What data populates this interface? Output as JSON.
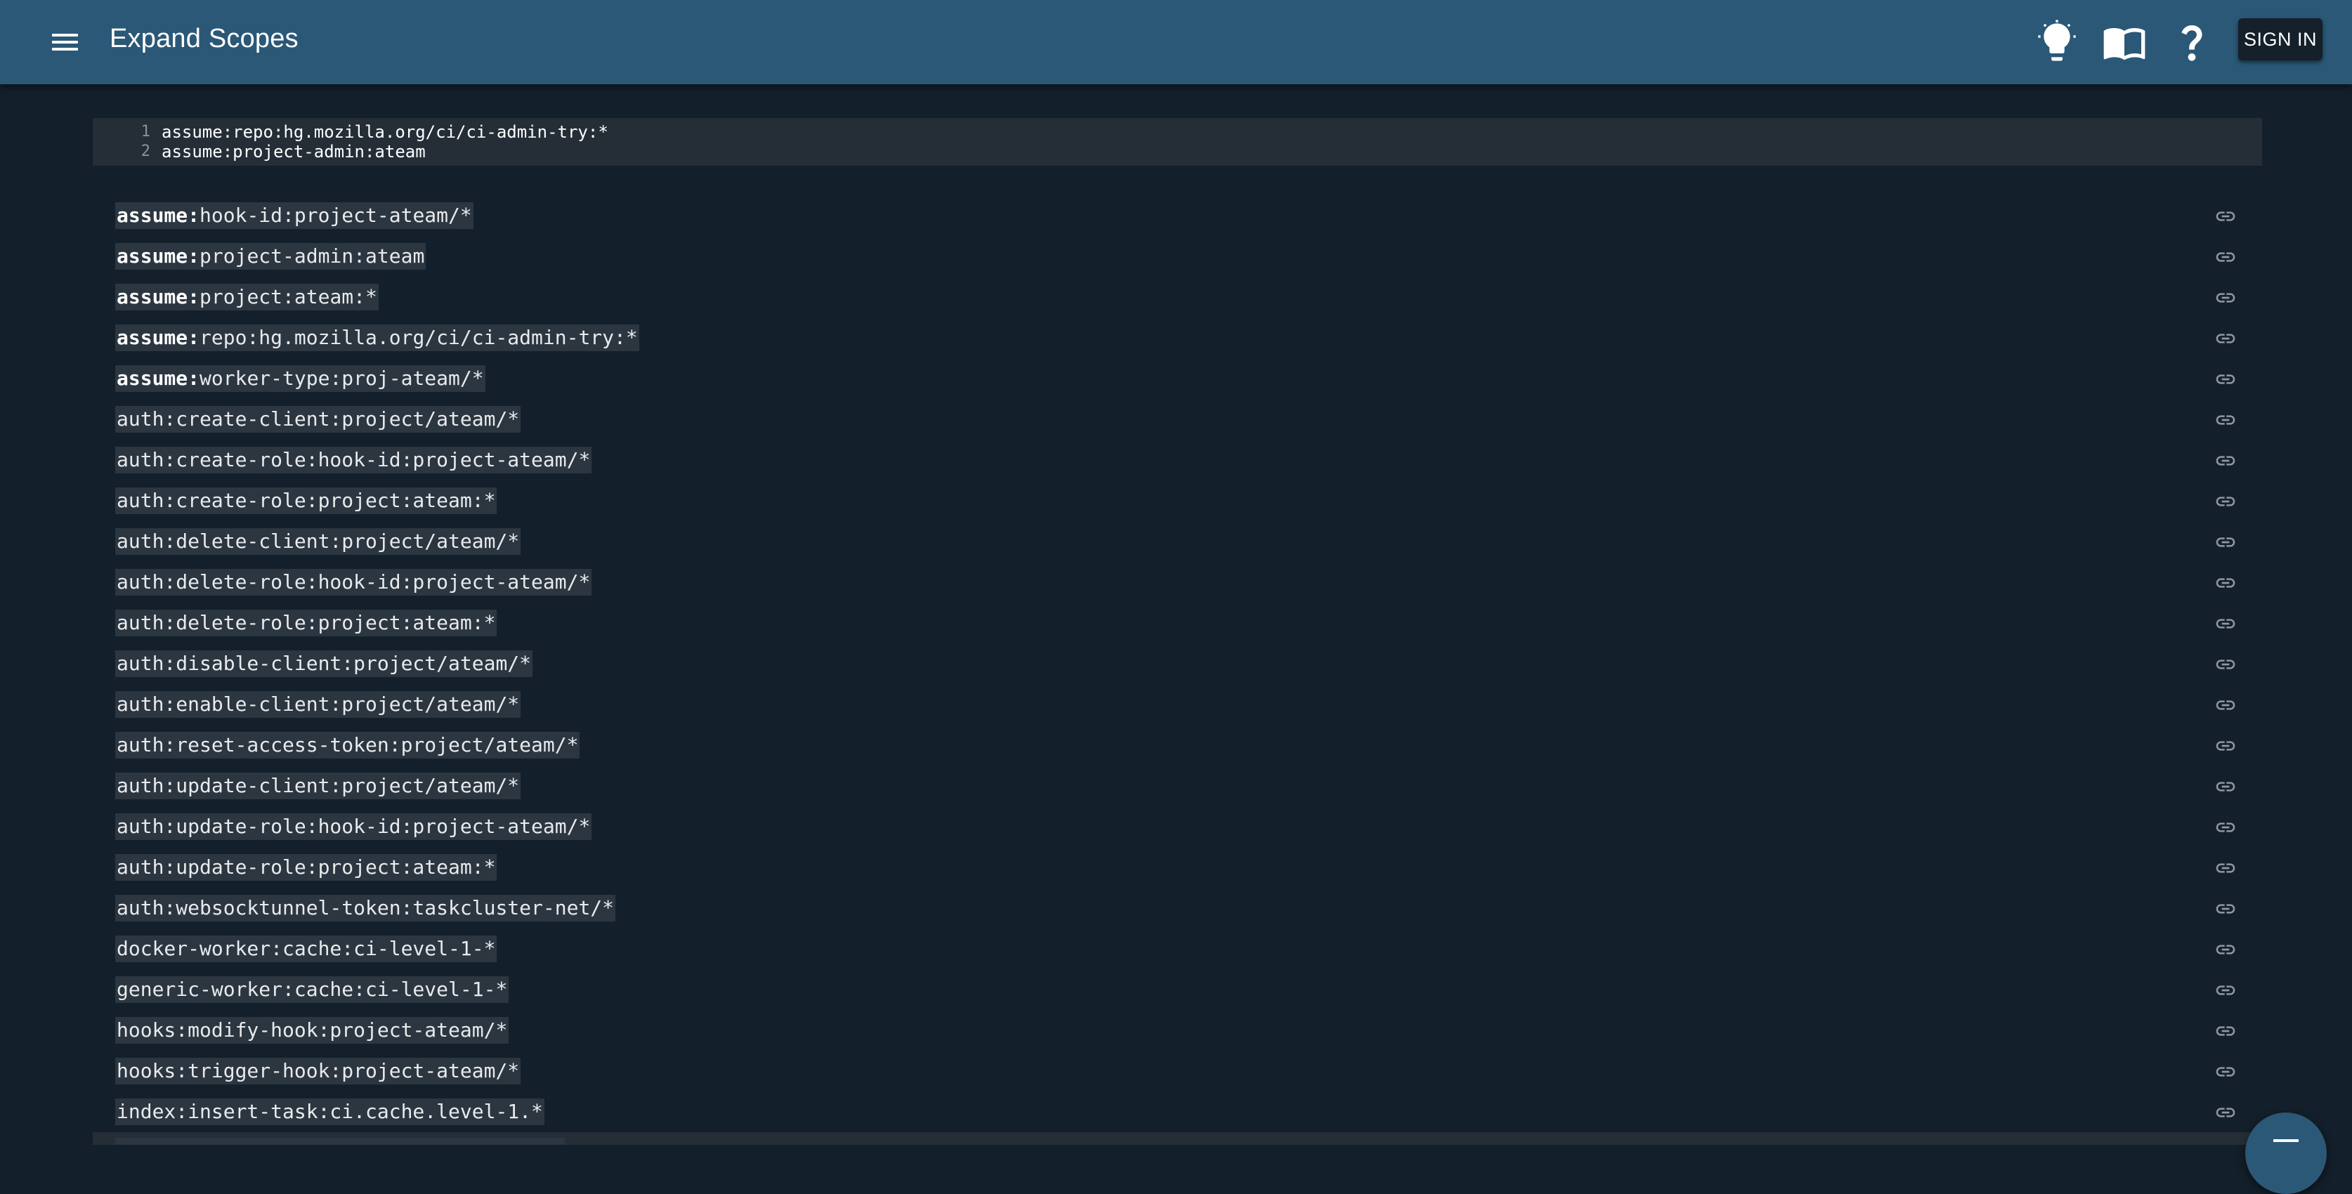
{
  "app": {
    "title": "Expand Scopes",
    "sign_in_label": "SIGN IN"
  },
  "icons": {
    "menu": "menu-icon",
    "theme": "lightbulb-icon",
    "docs": "book-icon",
    "help": "help-icon",
    "copy_link": "link-icon"
  },
  "editor": {
    "lines": [
      {
        "number": "1",
        "text": "assume:repo:hg.mozilla.org/ci/ci-admin-try:*"
      },
      {
        "number": "2",
        "text": "assume:project-admin:ateam"
      }
    ]
  },
  "scopes": [
    {
      "prefix": "assume:",
      "rest": "hook-id:project-ateam/*"
    },
    {
      "prefix": "assume:",
      "rest": "project-admin:ateam"
    },
    {
      "prefix": "assume:",
      "rest": "project:ateam:*"
    },
    {
      "prefix": "assume:",
      "rest": "repo:hg.mozilla.org/ci/ci-admin-try:*"
    },
    {
      "prefix": "assume:",
      "rest": "worker-type:proj-ateam/*"
    },
    {
      "prefix": "",
      "rest": "auth:create-client:project/ateam/*"
    },
    {
      "prefix": "",
      "rest": "auth:create-role:hook-id:project-ateam/*"
    },
    {
      "prefix": "",
      "rest": "auth:create-role:project:ateam:*"
    },
    {
      "prefix": "",
      "rest": "auth:delete-client:project/ateam/*"
    },
    {
      "prefix": "",
      "rest": "auth:delete-role:hook-id:project-ateam/*"
    },
    {
      "prefix": "",
      "rest": "auth:delete-role:project:ateam:*"
    },
    {
      "prefix": "",
      "rest": "auth:disable-client:project/ateam/*"
    },
    {
      "prefix": "",
      "rest": "auth:enable-client:project/ateam/*"
    },
    {
      "prefix": "",
      "rest": "auth:reset-access-token:project/ateam/*"
    },
    {
      "prefix": "",
      "rest": "auth:update-client:project/ateam/*"
    },
    {
      "prefix": "",
      "rest": "auth:update-role:hook-id:project-ateam/*"
    },
    {
      "prefix": "",
      "rest": "auth:update-role:project:ateam:*"
    },
    {
      "prefix": "",
      "rest": "auth:websocktunnel-token:taskcluster-net/*"
    },
    {
      "prefix": "",
      "rest": "docker-worker:cache:ci-level-1-*"
    },
    {
      "prefix": "",
      "rest": "generic-worker:cache:ci-level-1-*"
    },
    {
      "prefix": "",
      "rest": "hooks:modify-hook:project-ateam/*"
    },
    {
      "prefix": "",
      "rest": "hooks:trigger-hook:project-ateam/*"
    },
    {
      "prefix": "",
      "rest": "index:insert-task:ci.cache.level-1.*"
    }
  ],
  "colors": {
    "appbar": "#2b5877",
    "background": "#131f2a",
    "scope_highlight": "#2c3640",
    "editor_background": "#252e37"
  }
}
